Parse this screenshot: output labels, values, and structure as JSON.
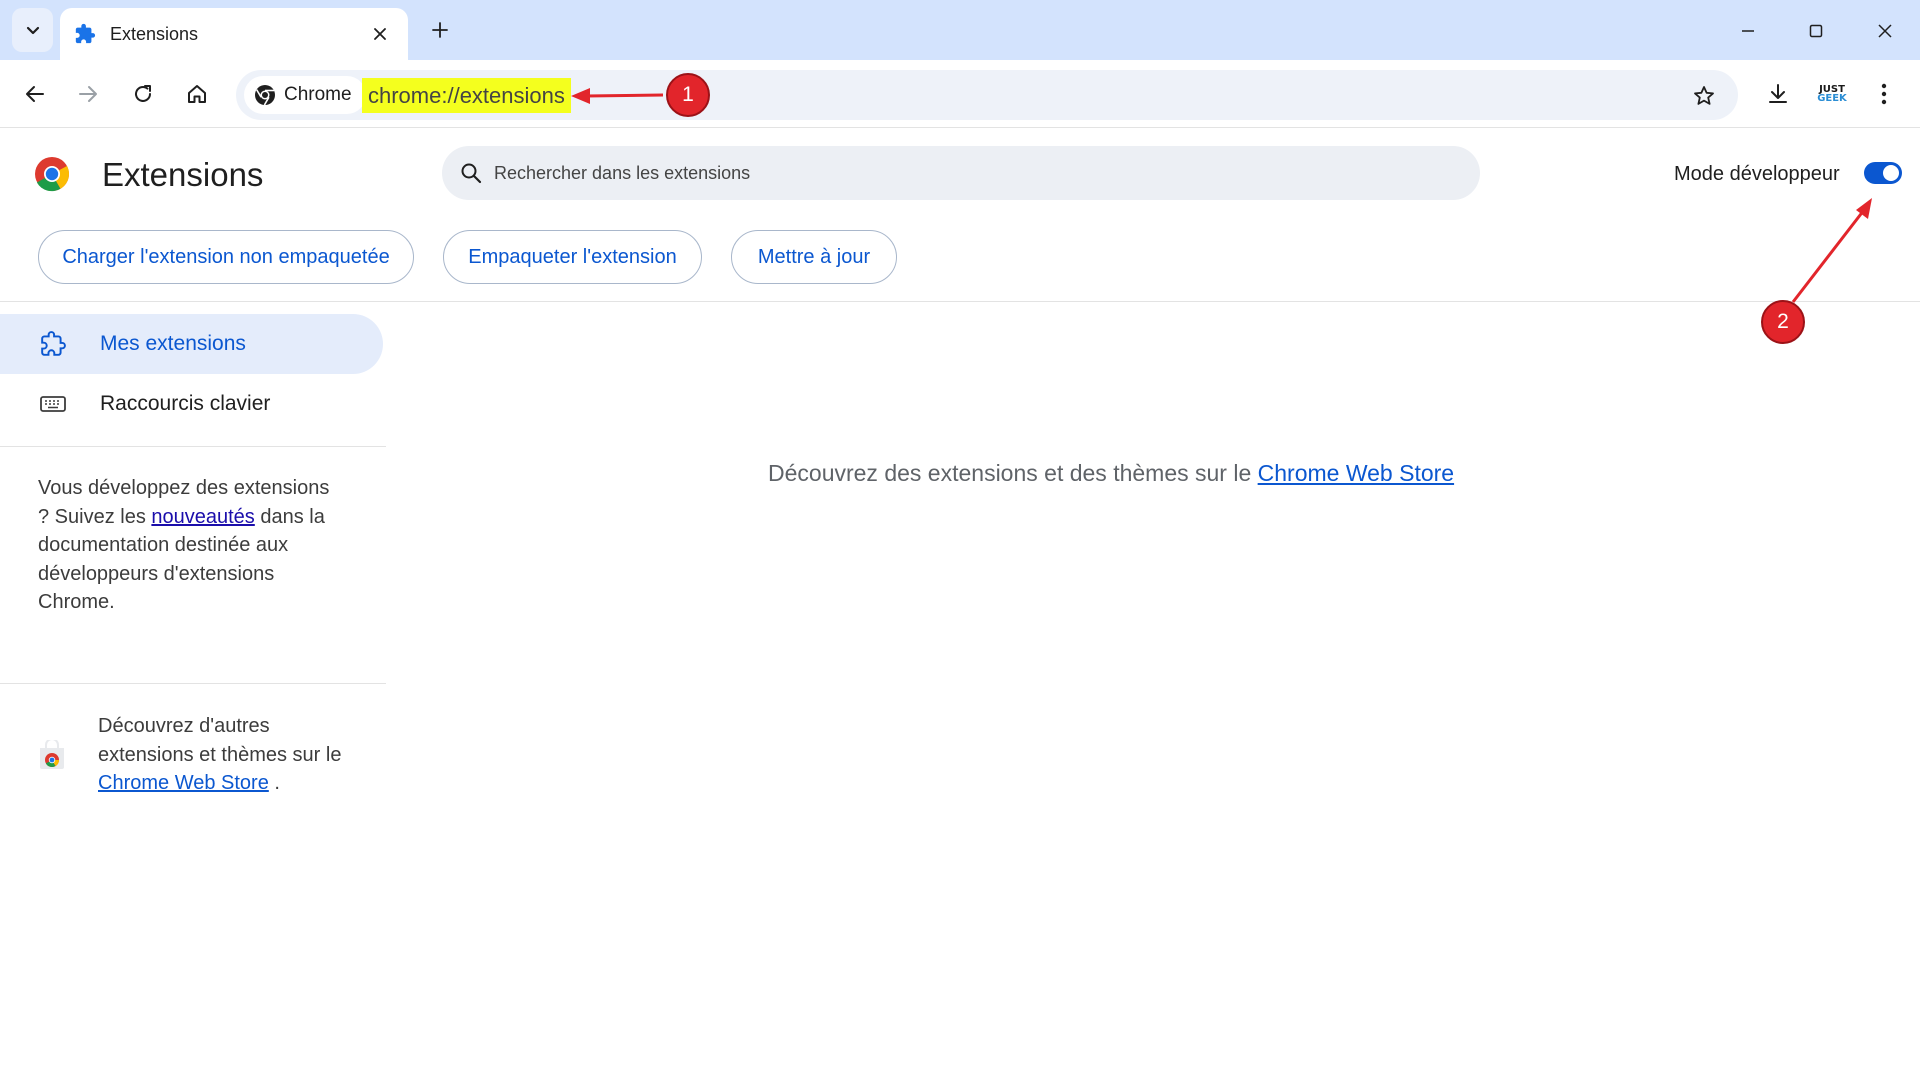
{
  "browser": {
    "tab_title": "Extensions",
    "chip_label": "Chrome",
    "url": "chrome://extensions",
    "extension_badge": {
      "line1": "JUST",
      "line2": "GEEK"
    }
  },
  "header": {
    "title": "Extensions",
    "search_placeholder": "Rechercher dans les extensions",
    "developer_mode_label": "Mode développeur",
    "developer_mode_on": true
  },
  "actions": {
    "load_unpacked": "Charger l'extension non empaquetée",
    "pack": "Empaqueter l'extension",
    "update": "Mettre à jour"
  },
  "sidebar": {
    "items": [
      {
        "label": "Mes extensions",
        "active": true
      },
      {
        "label": "Raccourcis clavier",
        "active": false
      }
    ],
    "dev_note": {
      "before": "Vous développez des extensions ? Suivez les ",
      "link": "nouveautés",
      "after": " dans la documentation destinée aux développeurs d'extensions Chrome."
    },
    "store_note": {
      "before": "Découvrez d'autres extensions et thèmes sur le ",
      "link": "Chrome Web Store",
      "after": " ."
    }
  },
  "main": {
    "message_before": "Découvrez des extensions et des thèmes sur le ",
    "message_link": "Chrome Web Store"
  },
  "annotations": {
    "badge1": "1",
    "badge2": "2",
    "color": "#e2252b"
  },
  "colors": {
    "accent": "#0b57d0",
    "tabstrip": "#d3e3fd",
    "url_highlight": "#f4ff1e"
  }
}
